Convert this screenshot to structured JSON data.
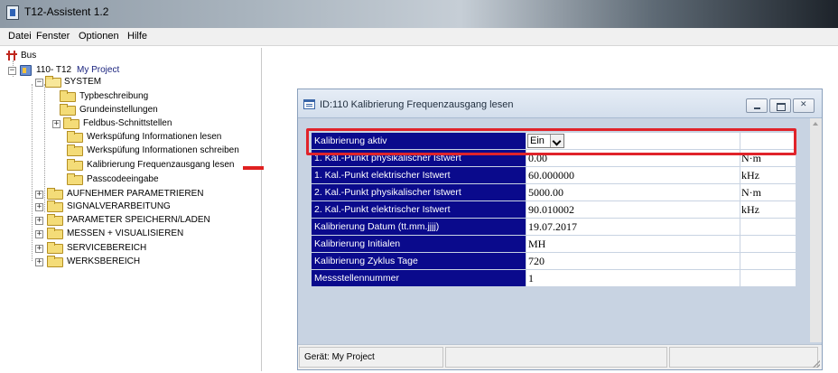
{
  "window": {
    "title": "T12-Assistent 1.2"
  },
  "menu": {
    "items": [
      "Datei",
      "Fenster",
      "Optionen",
      "Hilfe"
    ]
  },
  "tree": {
    "root": "Bus",
    "device": {
      "id": "110- T12",
      "project": "My Project"
    },
    "system": "SYSTEM",
    "system_children": [
      "Typbeschreibung",
      "Grundeinstellungen",
      "Feldbus-Schnittstellen",
      "Werkspüfung Informationen lesen",
      "Werkspüfung Informationen schreiben",
      "Kalibrierung Frequenzausgang lesen",
      "Passcodeeingabe"
    ],
    "top_folders": [
      "AUFNEHMER PARAMETRIEREN",
      "SIGNALVERARBEITUNG",
      "PARAMETER SPEICHERN/LADEN",
      "MESSEN + VISUALISIEREN",
      "SERVICEBEREICH",
      "WERKSBEREICH"
    ]
  },
  "child_window": {
    "title": "ID:110   Kalibrierung Frequenzausgang lesen",
    "status_device": "Gerät: My Project"
  },
  "grid": {
    "rows": [
      {
        "label": "Kalibrierung aktiv",
        "value": "Ein",
        "unit": ""
      },
      {
        "label": "1. Kal.-Punkt physikalischer Istwert",
        "value": "0.00",
        "unit": "N·m"
      },
      {
        "label": "1. Kal.-Punkt elektrischer Istwert",
        "value": "60.000000",
        "unit": "kHz"
      },
      {
        "label": "2. Kal.-Punkt physikalischer Istwert",
        "value": "5000.00",
        "unit": "N·m"
      },
      {
        "label": "2. Kal.-Punkt elektrischer Istwert",
        "value": "90.010002",
        "unit": "kHz"
      },
      {
        "label": "Kalibrierung Datum (tt.mm.jjjj)",
        "value": "19.07.2017",
        "unit": ""
      },
      {
        "label": "Kalibrierung Initialen",
        "value": "MH",
        "unit": ""
      },
      {
        "label": "Kalibrierung Zyklus Tage",
        "value": "720",
        "unit": ""
      },
      {
        "label": "Messstellennummer",
        "value": "1",
        "unit": ""
      }
    ]
  },
  "colors": {
    "label_bg": "#0a0a8c",
    "highlight": "#e0232a",
    "arrow": "#e02020",
    "window_bg": "#c8d3e2"
  },
  "icons": [
    "app-icon",
    "bus-icon",
    "device-icon",
    "folder-icon",
    "expand-icon",
    "collapse-icon",
    "table-window-icon",
    "minimize-icon",
    "maximize-icon",
    "close-icon",
    "dropdown-arrow-icon",
    "resize-grip-icon"
  ]
}
